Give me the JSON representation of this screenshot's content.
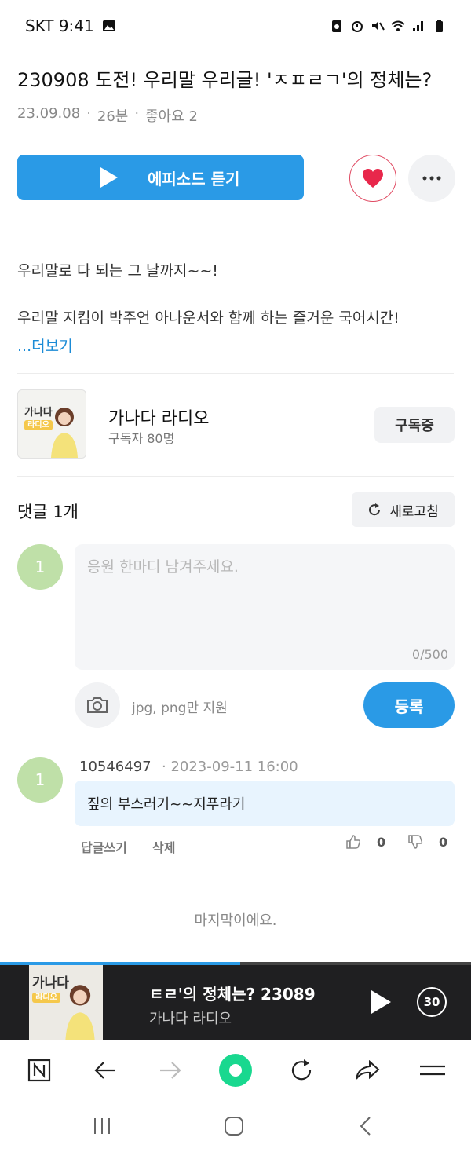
{
  "status": {
    "carrier_time": "SKT 9:41"
  },
  "episode": {
    "title": "230908 도전! 우리말 우리글! 'ㅈㅍㄹㄱ'의 정체는?",
    "date": "23.09.08",
    "duration": "26분",
    "likes": "좋아요 2",
    "play_label": "에피소드 듣기",
    "desc_line1": "우리말로 다 되는 그 날까지~~!",
    "desc_line2": "우리말 지킴이 박주언 아나운서와 함께 하는 즐거운 국어시간!",
    "more_label": "...더보기"
  },
  "channel": {
    "thumb_title": "가나다",
    "thumb_sub": "라디오",
    "name": "가나다 라디오",
    "subscribers": "구독자 80명",
    "subscribe_label": "구독중"
  },
  "comments": {
    "title": "댓글 1개",
    "refresh_label": "새로고침",
    "input": {
      "avatar": "1",
      "placeholder": "응원 한마디 남겨주세요.",
      "count": "0/500",
      "attach_hint": "jpg, png만 지원",
      "submit_label": "등록"
    },
    "items": [
      {
        "avatar": "1",
        "user": "10546497",
        "time": "· 2023-09-11 16:00",
        "text": "짚의 부스러기~~지푸라기",
        "reply_label": "답글쓰기",
        "delete_label": "삭제",
        "likes": "0",
        "dislikes": "0"
      }
    ],
    "end_message": "마지막이에요."
  },
  "player": {
    "thumb_title": "가나다",
    "thumb_sub": "라디오",
    "title": "ㅌㄹ'의 정체는?   23089",
    "subtitle": "가나다 라디오",
    "skip_label": "30",
    "progress": 0.51
  },
  "colors": {
    "accent": "#2a9ae6",
    "heart": "#e04b63",
    "avatar": "#bfe0a8"
  }
}
